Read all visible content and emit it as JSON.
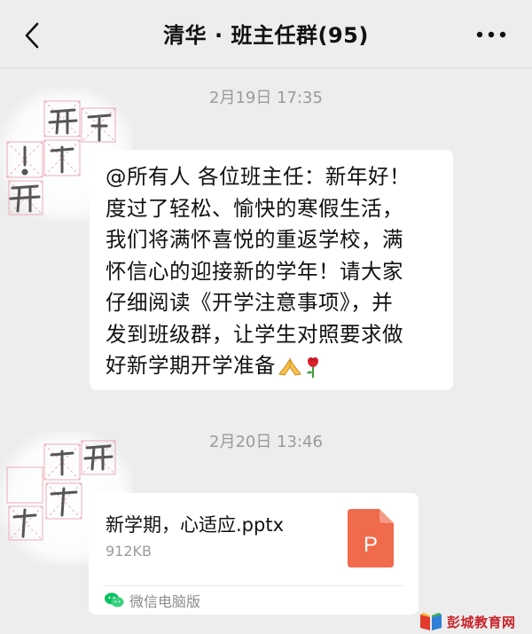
{
  "header": {
    "title": "清华 · 班主任群(95)",
    "back_icon": "chevron-left-icon",
    "more_icon": "more-dots-icon"
  },
  "messages": [
    {
      "timestamp": "2月19日 17:35",
      "type": "text",
      "lines": [
        "@所有人 各位班主任：新年好！",
        "度过了轻松、愉快的寒假生活，",
        "我们将满怀喜悦的重返学校，满",
        "怀信心的迎接新的学年！请大家",
        "仔细阅读《开学注意事项》，并",
        "发到班级群，让学生对照要求做",
        "好新学期开学准备"
      ],
      "emojis": [
        "folded-hands-emoji",
        "rose-emoji"
      ]
    },
    {
      "timestamp": "2月20日 13:46",
      "type": "file",
      "file_name": "新学期，心适应.pptx",
      "file_size": "912KB",
      "file_icon_letter": "P",
      "source_label": "微信电脑版",
      "source_icon": "wechat-icon"
    }
  ],
  "watermark": {
    "text": "彭城教育网",
    "icon": "book-icon"
  },
  "colors": {
    "background": "#ededed",
    "bubble": "#ffffff",
    "ppt_orange": "#f06a4c",
    "wechat_green": "#07c160",
    "watermark_red": "#c8242a"
  }
}
